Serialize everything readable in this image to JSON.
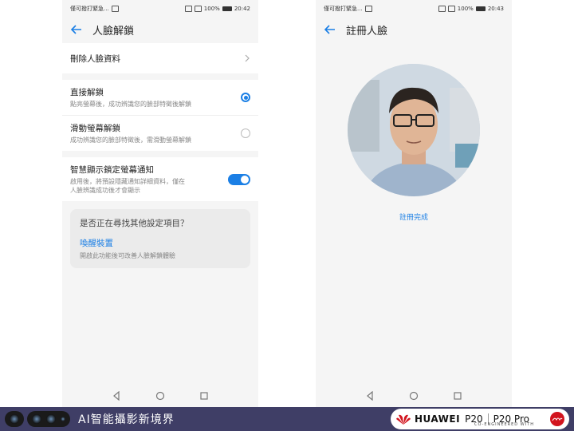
{
  "left_screen": {
    "status": {
      "carrier": "僅可撥打緊急...",
      "battery": "100%",
      "time": "20:42"
    },
    "title": "人臉解鎖",
    "delete_item": "刪除人臉資料",
    "options": [
      {
        "title": "直接解鎖",
        "subtitle": "點亮螢幕後，成功辨識您的臉部特徵後解鎖",
        "selected": true
      },
      {
        "title": "滑動螢幕解鎖",
        "subtitle": "成功辨識您的臉部特徵後，需滑動螢幕解鎖",
        "selected": false
      }
    ],
    "notify": {
      "title": "智慧顯示鎖定螢幕通知",
      "subtitle_line1": "啟用後，將預設隱藏通知詳細資料，僅在",
      "subtitle_line2": "人臉辨識成功後才會顯示",
      "enabled": true
    },
    "suggestion": {
      "question": "是否正在尋找其他設定項目？",
      "link": "喚醒裝置",
      "description": "開啟此功能後可改善人臉解鎖體驗"
    }
  },
  "right_screen": {
    "status": {
      "carrier": "僅可撥打緊急...",
      "battery": "100%",
      "time": "20:43"
    },
    "title": "註冊人臉",
    "done_text": "註冊完成"
  },
  "banner": {
    "tagline": "AI智能攝影新境界",
    "brand": "HUAWEI",
    "model_1": "P20",
    "model_2": "P20 Pro",
    "co_engineered": "CO-ENGINEERED WITH"
  },
  "colors": {
    "accent": "#1b7fe5",
    "banner_bg": "#3f3e66",
    "leica_red": "#d2141e"
  }
}
